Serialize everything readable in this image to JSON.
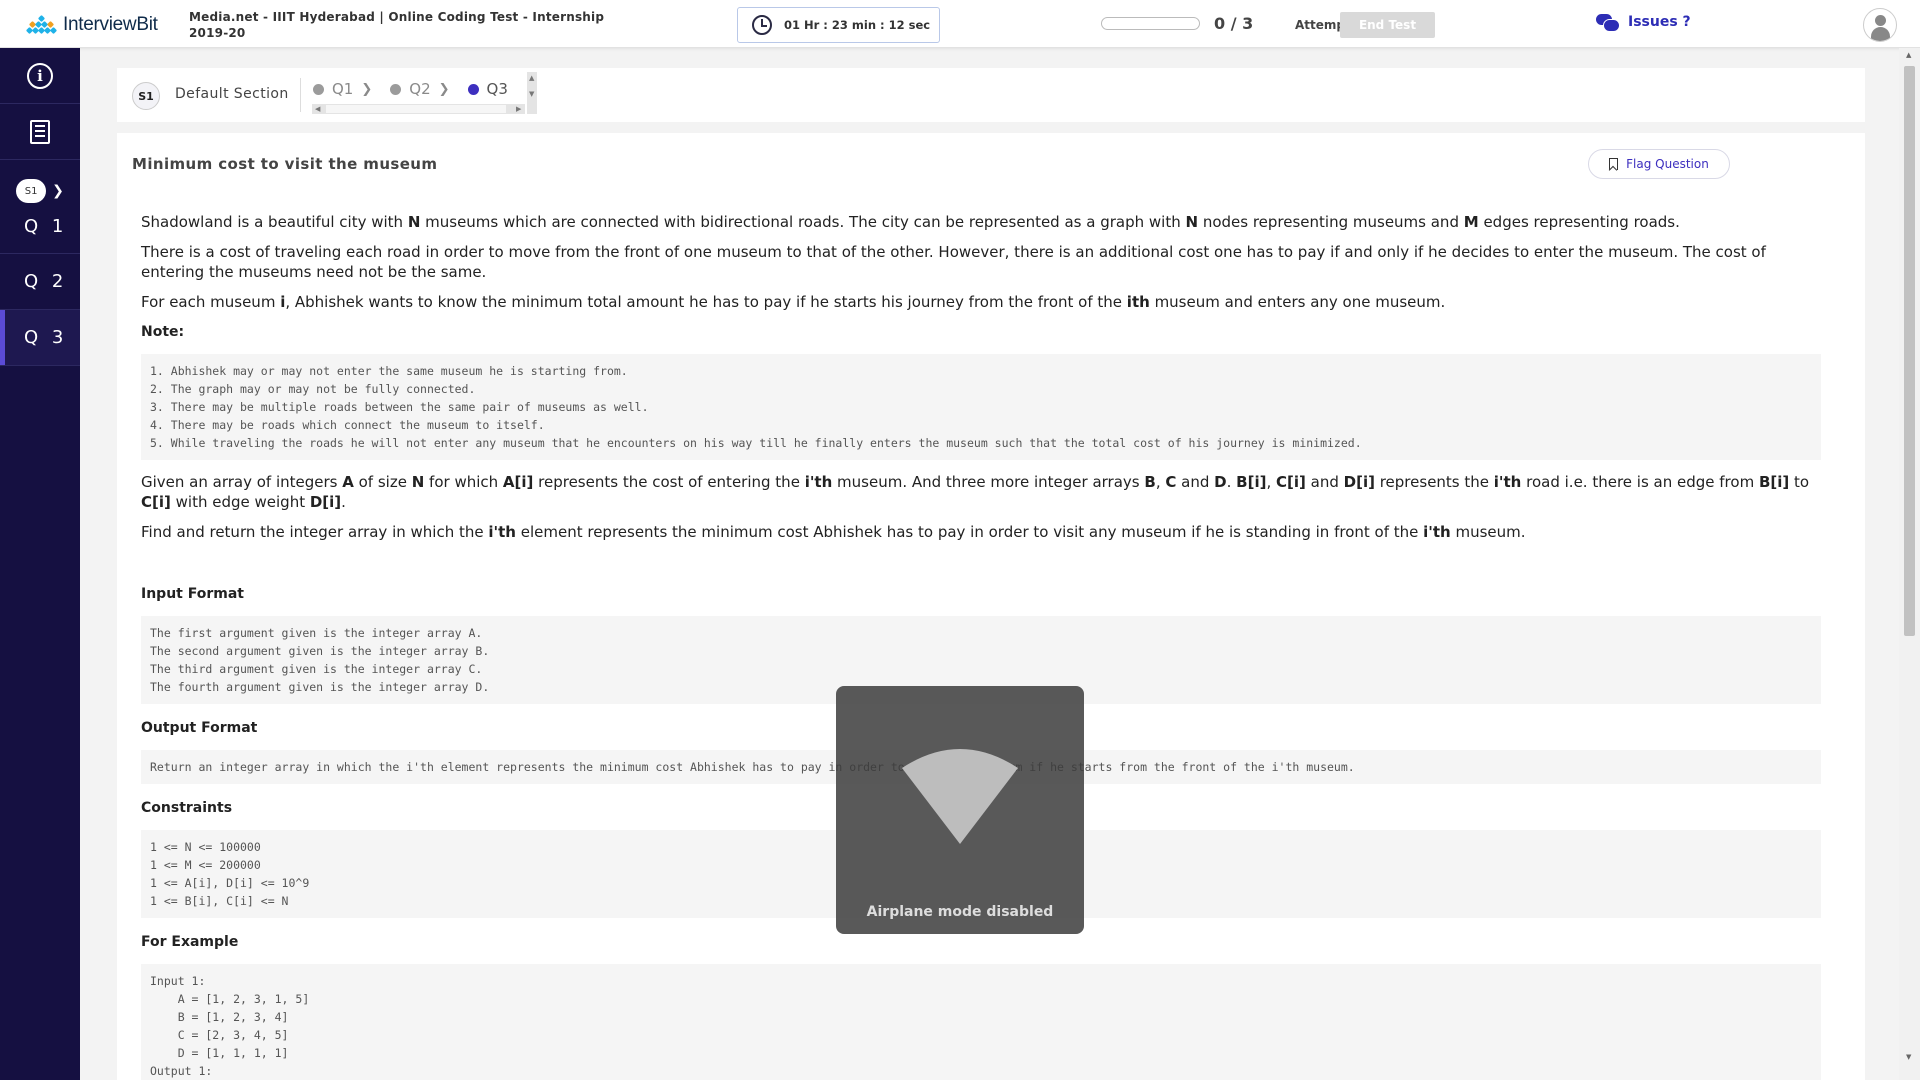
{
  "header": {
    "logo_text": "InterviewBit",
    "test_title": "Media.net - IIIT Hyderabad | Online Coding Test - Internship 2019-20",
    "timer": "01 Hr : 23 min : 12 sec",
    "progress_fraction": 0,
    "attempt_count": "0 / 3",
    "attempt_label": "Attempted",
    "end_test_label": "End Test",
    "issues_label": "Issues ?"
  },
  "sidebar": {
    "section_badge": "S1",
    "questions": [
      {
        "label": "Q 1"
      },
      {
        "label": "Q 2"
      },
      {
        "label": "Q 3"
      }
    ],
    "active_index": 2
  },
  "section_bar": {
    "badge": "S1",
    "name": "Default Section",
    "tabs": [
      {
        "label": "Q1"
      },
      {
        "label": "Q2"
      },
      {
        "label": "Q3"
      }
    ]
  },
  "question": {
    "title": "Minimum cost to visit the museum",
    "flag_label": "Flag Question",
    "p1": [
      "Shadowland is a beautiful city with ",
      "N",
      " museums which are connected with bidirectional roads. The city can be represented as a graph with ",
      "N",
      " nodes representing museums and ",
      "M",
      " edges representing roads."
    ],
    "p2": "There is a cost of traveling each road in order to move from the front of one museum to that of the other. However, there is an additional cost one has to pay if and only if he decides to enter the museum. The cost of entering the museums need not be the same.",
    "p3": [
      "For each museum ",
      "i",
      ", Abhishek wants to know the minimum total amount he has to pay if he starts his journey from the front of the ",
      "ith",
      " museum and enters any one museum."
    ],
    "note_label": "Note:",
    "notes": "1. Abhishek may or may not enter the same museum he is starting from.\n2. The graph may or may not be fully connected.\n3. There may be multiple roads between the same pair of museums as well.\n4. There may be roads which connect the museum to itself.\n5. While traveling the roads he will not enter any museum that he encounters on his way till he finally enters the museum such that the total cost of his journey is minimized.",
    "p4": [
      "Given an array of integers ",
      "A",
      " of size ",
      "N",
      " for which ",
      "A[i]",
      " represents the cost of entering the ",
      "i'th",
      " museum. And three more integer arrays ",
      "B",
      ", ",
      "C",
      " and ",
      "D",
      ". ",
      "B[i]",
      ", ",
      "C[i]",
      " and ",
      "D[i]",
      " represents the ",
      "i'th",
      " road i.e. there is an edge from ",
      "B[i]",
      " to ",
      "C[i]",
      " with edge weight ",
      "D[i]",
      "."
    ],
    "p5": [
      "Find and return the integer array in which the ",
      "i'th",
      " element represents the minimum cost Abhishek has to pay in order to visit any museum if he is standing in front of the ",
      "i'th",
      " museum."
    ],
    "input_format_label": "Input Format",
    "input_format": "The first argument given is the integer array A.\nThe second argument given is the integer array B.\nThe third argument given is the integer array C.\nThe fourth argument given is the integer array D.",
    "output_format_label": "Output Format",
    "output_format": "Return an integer array in which the i'th element represents the minimum cost Abhishek has to pay in order to enter any museum if he starts from the front of the i'th museum.",
    "constraints_label": "Constraints",
    "constraints": "1 <= N <= 100000\n1 <= M <= 200000\n1 <= A[i], D[i] <= 10^9\n1 <= B[i], C[i] <= N",
    "example_label": "For Example",
    "example": "Input 1:\n    A = [1, 2, 3, 1, 5]\n    B = [1, 2, 3, 4]\n    C = [2, 3, 4, 5]\n    D = [1, 1, 1, 1]\nOutput 1:"
  },
  "osd": {
    "label": "Airplane mode disabled"
  },
  "colors": {
    "sidebar_bg": "#151041",
    "accent": "#3d2fbf",
    "issues": "#2d2db5"
  }
}
